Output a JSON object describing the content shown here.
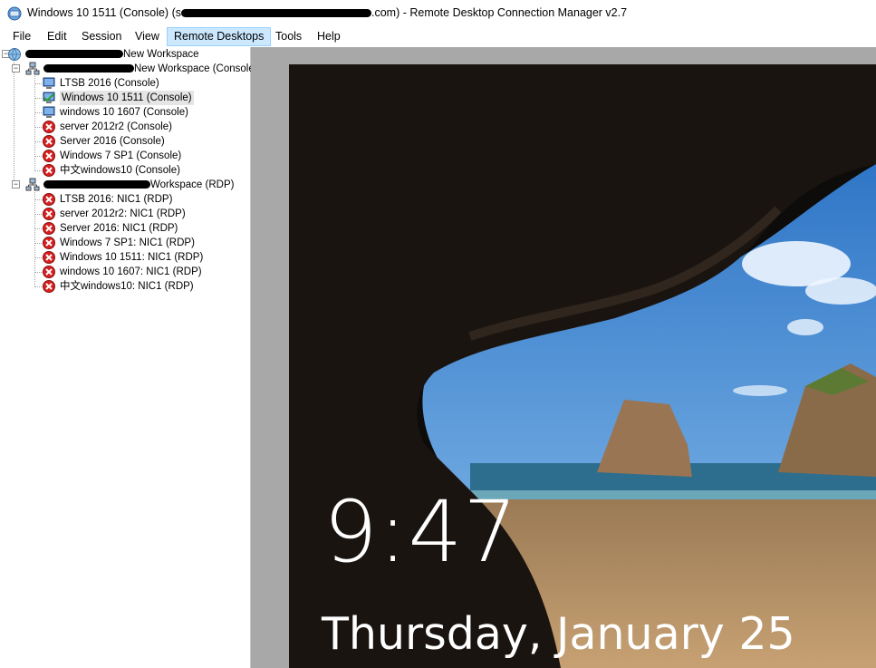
{
  "window": {
    "title_prefix": "Windows 10 1511 (Console) (s",
    "title_suffix": ".com) - Remote Desktop Connection Manager v2.7"
  },
  "menu": [
    "File",
    "Edit",
    "Session",
    "View",
    "Remote Desktops",
    "Tools",
    "Help"
  ],
  "menu_active": "Remote Desktops",
  "tree": {
    "root": {
      "label_tail": "New Workspace"
    },
    "groups": [
      {
        "label_tail": "New Workspace (Console)",
        "items": [
          {
            "label": "LTSB 2016 (Console)",
            "status": "connected-icon"
          },
          {
            "label": "Windows 10 1511 (Console)",
            "status": "active-connected-icon",
            "selected": true
          },
          {
            "label": "windows 10 1607 (Console)",
            "status": "connected-icon"
          },
          {
            "label": "server 2012r2 (Console)",
            "status": "error-icon"
          },
          {
            "label": "Server 2016 (Console)",
            "status": "error-icon"
          },
          {
            "label": "Windows 7 SP1 (Console)",
            "status": "error-icon"
          },
          {
            "label": "中文windows10 (Console)",
            "status": "error-icon"
          }
        ]
      },
      {
        "label_tail": "Workspace (RDP)",
        "items": [
          {
            "label": "LTSB 2016: NIC1 (RDP)",
            "status": "error-icon"
          },
          {
            "label": "server 2012r2: NIC1 (RDP)",
            "status": "error-icon"
          },
          {
            "label": "Server 2016: NIC1 (RDP)",
            "status": "error-icon"
          },
          {
            "label": "Windows 7 SP1: NIC1 (RDP)",
            "status": "error-icon"
          },
          {
            "label": "Windows 10 1511: NIC1 (RDP)",
            "status": "error-icon"
          },
          {
            "label": "windows 10 1607: NIC1 (RDP)",
            "status": "error-icon"
          },
          {
            "label": "中文windows10: NIC1 (RDP)",
            "status": "error-icon"
          }
        ]
      }
    ]
  },
  "lockscreen": {
    "time": "9:47",
    "date": "Thursday, January 25"
  },
  "colors": {
    "menu_active_bg": "#cce8ff",
    "viewer_bg": "#a8a8a8",
    "error_red": "#d62020"
  }
}
